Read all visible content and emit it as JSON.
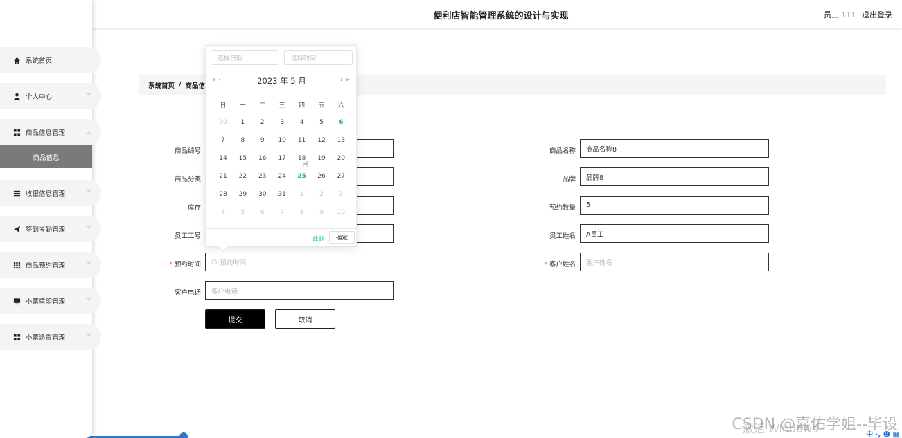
{
  "header": {
    "title": "便利店智能管理系统的设计与实现",
    "user": "员工 111",
    "logout": "退出登录"
  },
  "sidebar": {
    "items": [
      {
        "label": "系统首页",
        "icon": "home-icon"
      },
      {
        "label": "个人中心",
        "icon": "user-icon"
      },
      {
        "label": "商品信息管理",
        "icon": "grid-icon"
      },
      {
        "label": "收银信息管理",
        "icon": "list-icon"
      },
      {
        "label": "签到考勤管理",
        "icon": "send-icon"
      },
      {
        "label": "商品预约管理",
        "icon": "apps-icon"
      },
      {
        "label": "小票重印管理",
        "icon": "monitor-icon"
      },
      {
        "label": "小票退货管理",
        "icon": "grid-icon"
      }
    ],
    "sub_item": "商品信息"
  },
  "breadcrumb": {
    "home": "系统首页",
    "sep": "/",
    "current": "商品信"
  },
  "form": {
    "goods_code_label": "商品编号",
    "goods_name_label": "商品名称",
    "goods_name_value": "商品名称8",
    "category_label": "商品分类",
    "brand_label": "品牌",
    "brand_value": "品牌8",
    "stock_label": "库存",
    "reserve_qty_label": "预约数量",
    "reserve_qty_value": "5",
    "emp_no_label": "员工工号",
    "emp_name_label": "员工姓名",
    "emp_name_value": "A员工",
    "reserve_time_label": "预约时间",
    "reserve_time_placeholder": "预约时间",
    "customer_name_label": "客户姓名",
    "customer_name_placeholder": "客户姓名",
    "customer_phone_label": "客户电话",
    "customer_phone_placeholder": "客户电话",
    "required_mark": "*",
    "submit": "提交",
    "cancel": "取消"
  },
  "picker": {
    "date_placeholder": "选择日期",
    "time_placeholder": "选择时间",
    "prev_year": "«",
    "prev_month": "‹",
    "next_month": "›",
    "next_year": "»",
    "year_month": "2023 年  5 月",
    "weekdays": [
      "日",
      "一",
      "二",
      "三",
      "四",
      "五",
      "六"
    ],
    "weeks": [
      [
        "30",
        "1",
        "2",
        "3",
        "4",
        "5",
        "6"
      ],
      [
        "7",
        "8",
        "9",
        "10",
        "11",
        "12",
        "13"
      ],
      [
        "14",
        "15",
        "16",
        "17",
        "18",
        "19",
        "20"
      ],
      [
        "21",
        "22",
        "23",
        "24",
        "25",
        "26",
        "27"
      ],
      [
        "28",
        "29",
        "30",
        "31",
        "1",
        "2",
        "3"
      ],
      [
        "4",
        "5",
        "6",
        "7",
        "8",
        "9",
        "10"
      ]
    ],
    "now": "此刻",
    "confirm": "确定",
    "today_color": "#19b38a"
  },
  "watermark": "CSDN @嘉佑学姐--毕设",
  "activate_hint": "激活 Windows",
  "taskbar_text": "中 ·, ☻ ▦"
}
